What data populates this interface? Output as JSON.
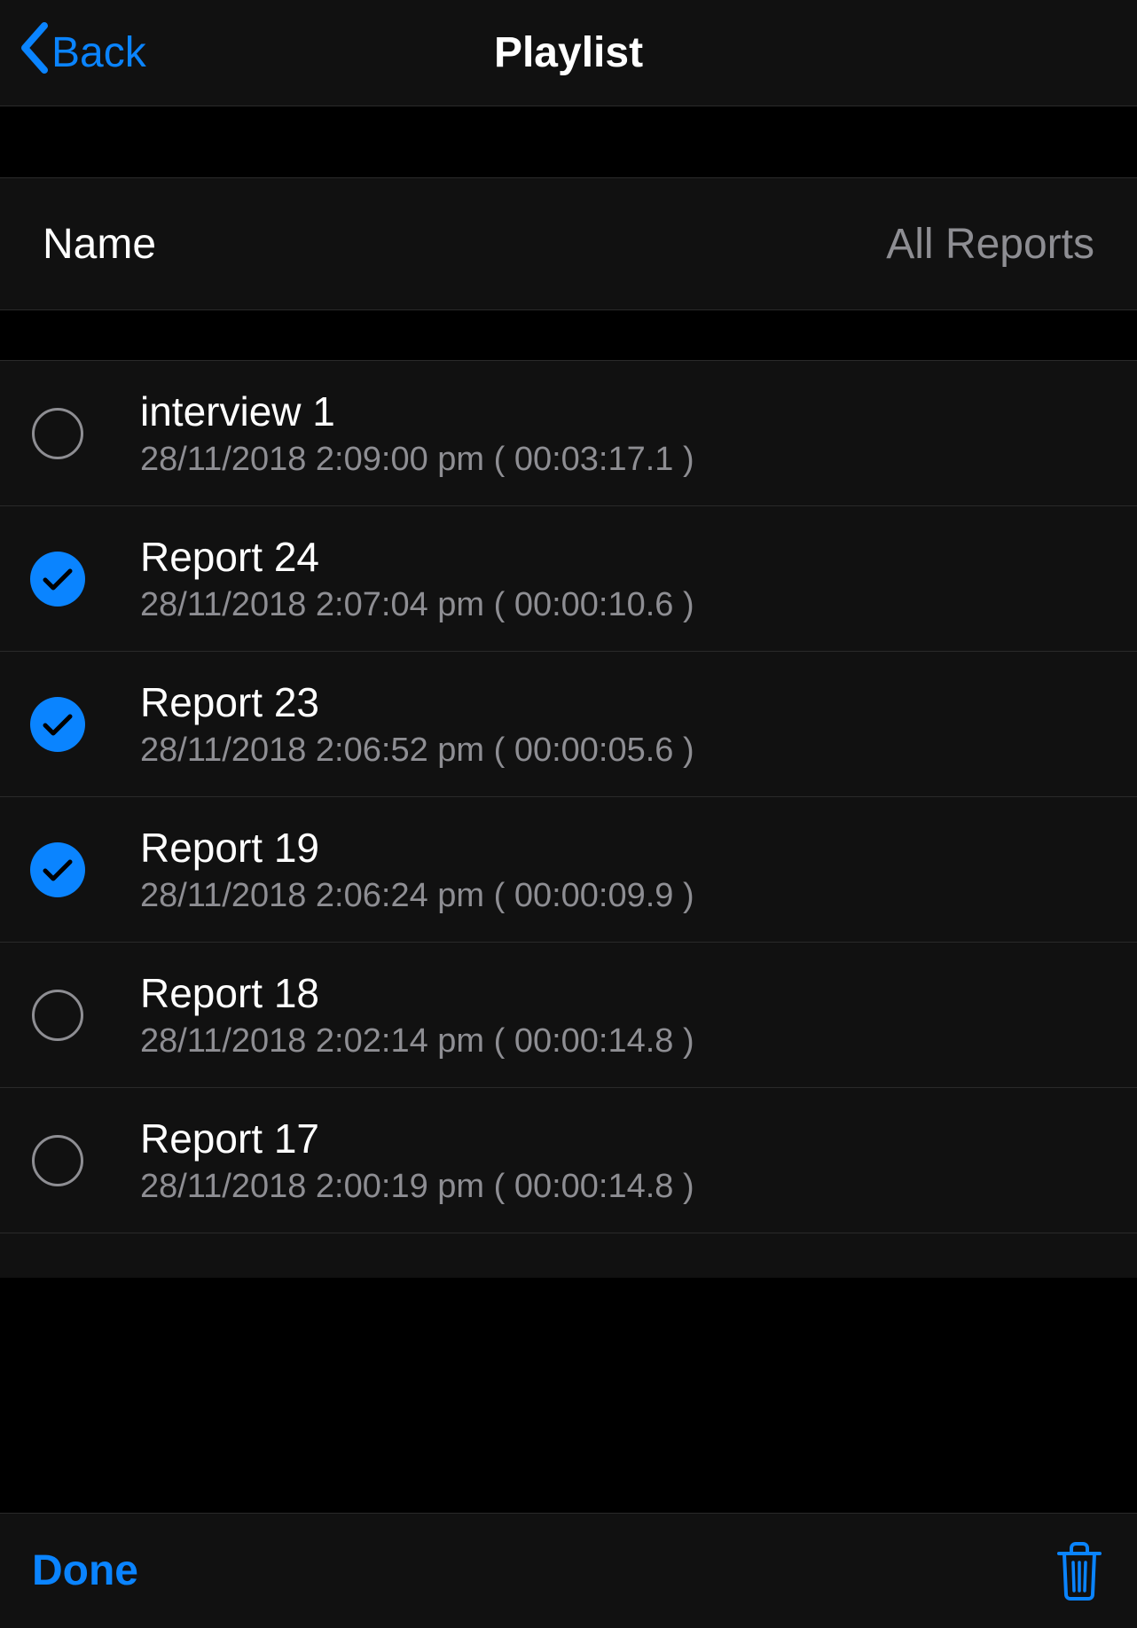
{
  "nav": {
    "back_label": "Back",
    "title": "Playlist"
  },
  "header": {
    "name_label": "Name",
    "filter_label": "All Reports"
  },
  "items": [
    {
      "title": "interview 1",
      "subtitle": "28/11/2018 2:09:00 pm ( 00:03:17.1 )",
      "selected": false
    },
    {
      "title": "Report 24",
      "subtitle": "28/11/2018 2:07:04 pm ( 00:00:10.6 )",
      "selected": true
    },
    {
      "title": "Report 23",
      "subtitle": "28/11/2018 2:06:52 pm ( 00:00:05.6 )",
      "selected": true
    },
    {
      "title": "Report 19",
      "subtitle": "28/11/2018 2:06:24 pm ( 00:00:09.9 )",
      "selected": true
    },
    {
      "title": "Report 18",
      "subtitle": "28/11/2018 2:02:14 pm ( 00:00:14.8 )",
      "selected": false
    },
    {
      "title": "Report 17",
      "subtitle": "28/11/2018 2:00:19 pm ( 00:00:14.8 )",
      "selected": false
    }
  ],
  "toolbar": {
    "done_label": "Done"
  }
}
